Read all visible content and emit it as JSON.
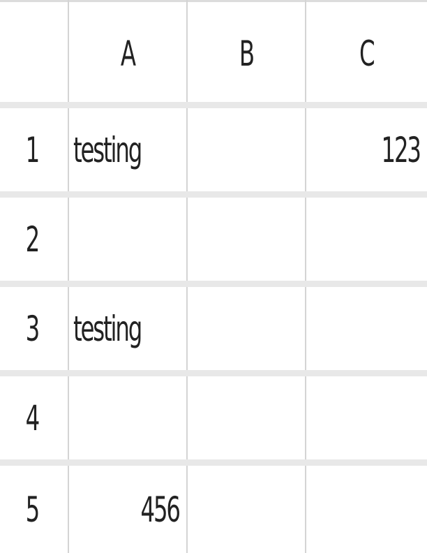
{
  "spreadsheet": {
    "columns": [
      "A",
      "B",
      "C"
    ],
    "rows": [
      {
        "row": "1",
        "cells": [
          "testing",
          "",
          "123"
        ]
      },
      {
        "row": "2",
        "cells": [
          "",
          "",
          ""
        ]
      },
      {
        "row": "3",
        "cells": [
          "testing",
          "",
          ""
        ]
      },
      {
        "row": "4",
        "cells": [
          "",
          "",
          ""
        ]
      },
      {
        "row": "5",
        "cells": [
          "456",
          "",
          ""
        ]
      }
    ]
  }
}
